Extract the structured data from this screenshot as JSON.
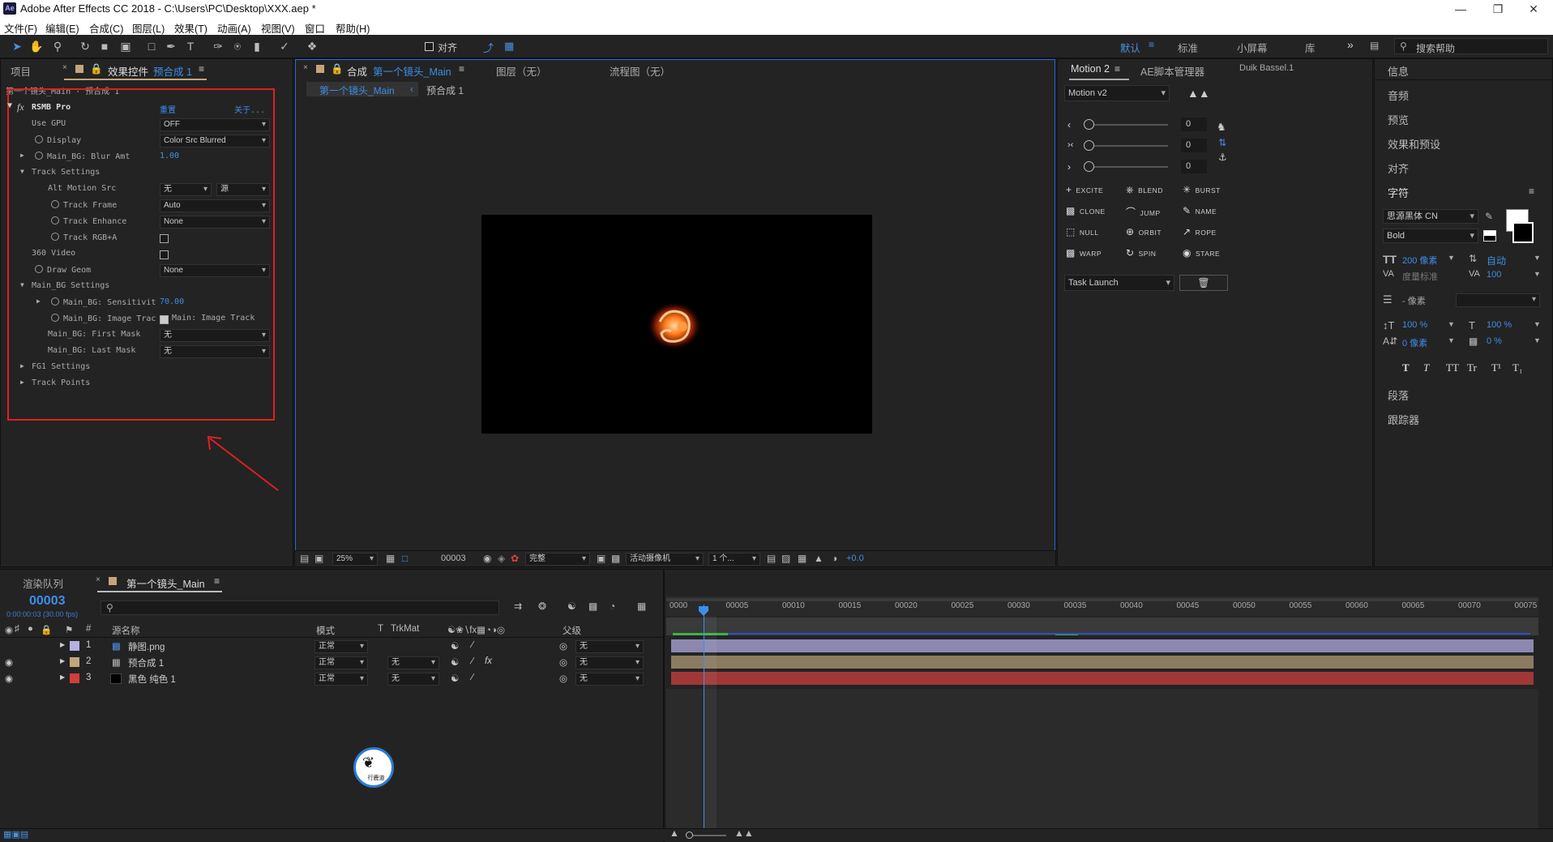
{
  "window": {
    "title": "Adobe After Effects CC 2018 - C:\\Users\\PC\\Desktop\\XXX.aep *",
    "app_badge": "Ae"
  },
  "menu": [
    "文件(F)",
    "编辑(E)",
    "合成(C)",
    "图层(L)",
    "效果(T)",
    "动画(A)",
    "视图(V)",
    "窗口",
    "帮助(H)"
  ],
  "toolbar": {
    "align_label": "对齐",
    "workspaces": [
      "默认",
      "标准",
      "小屏幕",
      "库"
    ],
    "search_placeholder": "搜索帮助"
  },
  "project_panel": {
    "tab_project": "项目",
    "tab_effects": "效果控件",
    "effects_target": "预合成 1",
    "breadcrumb": "第一个镜头_Main · 预合成 1"
  },
  "effect": {
    "name": "RSMB Pro",
    "reset": "重置",
    "about": "关于...",
    "rows": {
      "use_gpu": {
        "label": "Use GPU",
        "value": "OFF"
      },
      "display": {
        "label": "Display",
        "value": "Color Src Blurred"
      },
      "blur_amt": {
        "label": "Main_BG: Blur Amt",
        "value": "1.00"
      },
      "track_settings": "Track Settings",
      "alt_motion": {
        "label": "Alt Motion Src",
        "value1": "无",
        "value2": "源"
      },
      "track_frame": {
        "label": "Track Frame",
        "value": "Auto"
      },
      "track_enhance": {
        "label": "Track Enhance",
        "value": "None"
      },
      "track_rgba": {
        "label": "Track RGB+A"
      },
      "video360": {
        "label": "360 Video"
      },
      "draw_geom": {
        "label": "Draw Geom",
        "value": "None"
      },
      "main_bg_settings": "Main_BG Settings",
      "sensitivity": {
        "label": "Main_BG: Sensitivit",
        "value": "70.00"
      },
      "image_track": {
        "label": "Main_BG: Image Trac",
        "value": "Main: Image Track"
      },
      "first_mask": {
        "label": "Main_BG: First Mask",
        "value": "无"
      },
      "last_mask": {
        "label": "Main_BG: Last Mask",
        "value": "无"
      },
      "fg1": "FG1 Settings",
      "track_points": "Track Points"
    }
  },
  "comp_panel": {
    "tab_prefix": "合成",
    "comp_name": "第一个镜头_Main",
    "layer_tab": "图层（无）",
    "flow_tab": "流程图（无）",
    "crumb_comp": "第一个镜头_Main",
    "crumb_pre": "预合成 1",
    "footer": {
      "zoom": "25%",
      "time": "00003",
      "quality": "完整",
      "camera": "活动摄像机",
      "views": "1 个...",
      "exposure": "+0.0"
    }
  },
  "motion_panel": {
    "tab": "Motion 2",
    "tab2": "AE脚本管理器",
    "tab3": "Duik Bassel.1",
    "preset": "Motion v2",
    "sliders": [
      "0",
      "0",
      "0"
    ],
    "buttons": [
      "EXCITE",
      "BLEND",
      "BURST",
      "CLONE",
      "JUMP",
      "NAME",
      "NULL",
      "ORBIT",
      "ROPE",
      "WARP",
      "SPIN",
      "STARE"
    ],
    "task": "Task Launch"
  },
  "right_panel": {
    "items": [
      "信息",
      "音频",
      "预览",
      "效果和预设",
      "对齐"
    ],
    "char_title": "字符",
    "font": "思源黑体 CN",
    "style": "Bold",
    "size": "200 像素",
    "leading": "自动",
    "kerning": "度量标准",
    "tracking": "100",
    "stroke": "- 像素",
    "vscale": "100 %",
    "hscale": "100 %",
    "baseline": "0 像素",
    "tsume": "0 %",
    "type_buttons": [
      "T",
      "T",
      "TT",
      "Tr",
      "T¹",
      "T₁"
    ],
    "para": "段落",
    "tracker": "跟踪器"
  },
  "timeline": {
    "tab_render": "渲染队列",
    "tab_comp": "第一个镜头_Main",
    "timecode": "00003",
    "fps": "0:00:00:03 (30.00 fps)",
    "headers": {
      "name": "源名称",
      "mode": "模式",
      "t": "T",
      "trkmat": "TrkMat",
      "parent": "父级",
      "num": "#"
    },
    "layers": [
      {
        "num": "1",
        "name": "静图.png",
        "mode": "正常",
        "trkmat": "",
        "parent": "无",
        "color": "#b4b0e0"
      },
      {
        "num": "2",
        "name": "预合成 1",
        "mode": "正常",
        "trkmat": "无",
        "parent": "无",
        "color": "#c4a57a"
      },
      {
        "num": "3",
        "name": "黑色 纯色 1",
        "mode": "正常",
        "trkmat": "无",
        "parent": "无",
        "color": "#d23c3c"
      }
    ],
    "ruler": [
      "0000",
      "00005",
      "00010",
      "00015",
      "00020",
      "00025",
      "00030",
      "00035",
      "00040",
      "00045",
      "00050",
      "00055",
      "00060",
      "00065",
      "00070",
      "00075"
    ],
    "watermark": "行鹿道"
  }
}
